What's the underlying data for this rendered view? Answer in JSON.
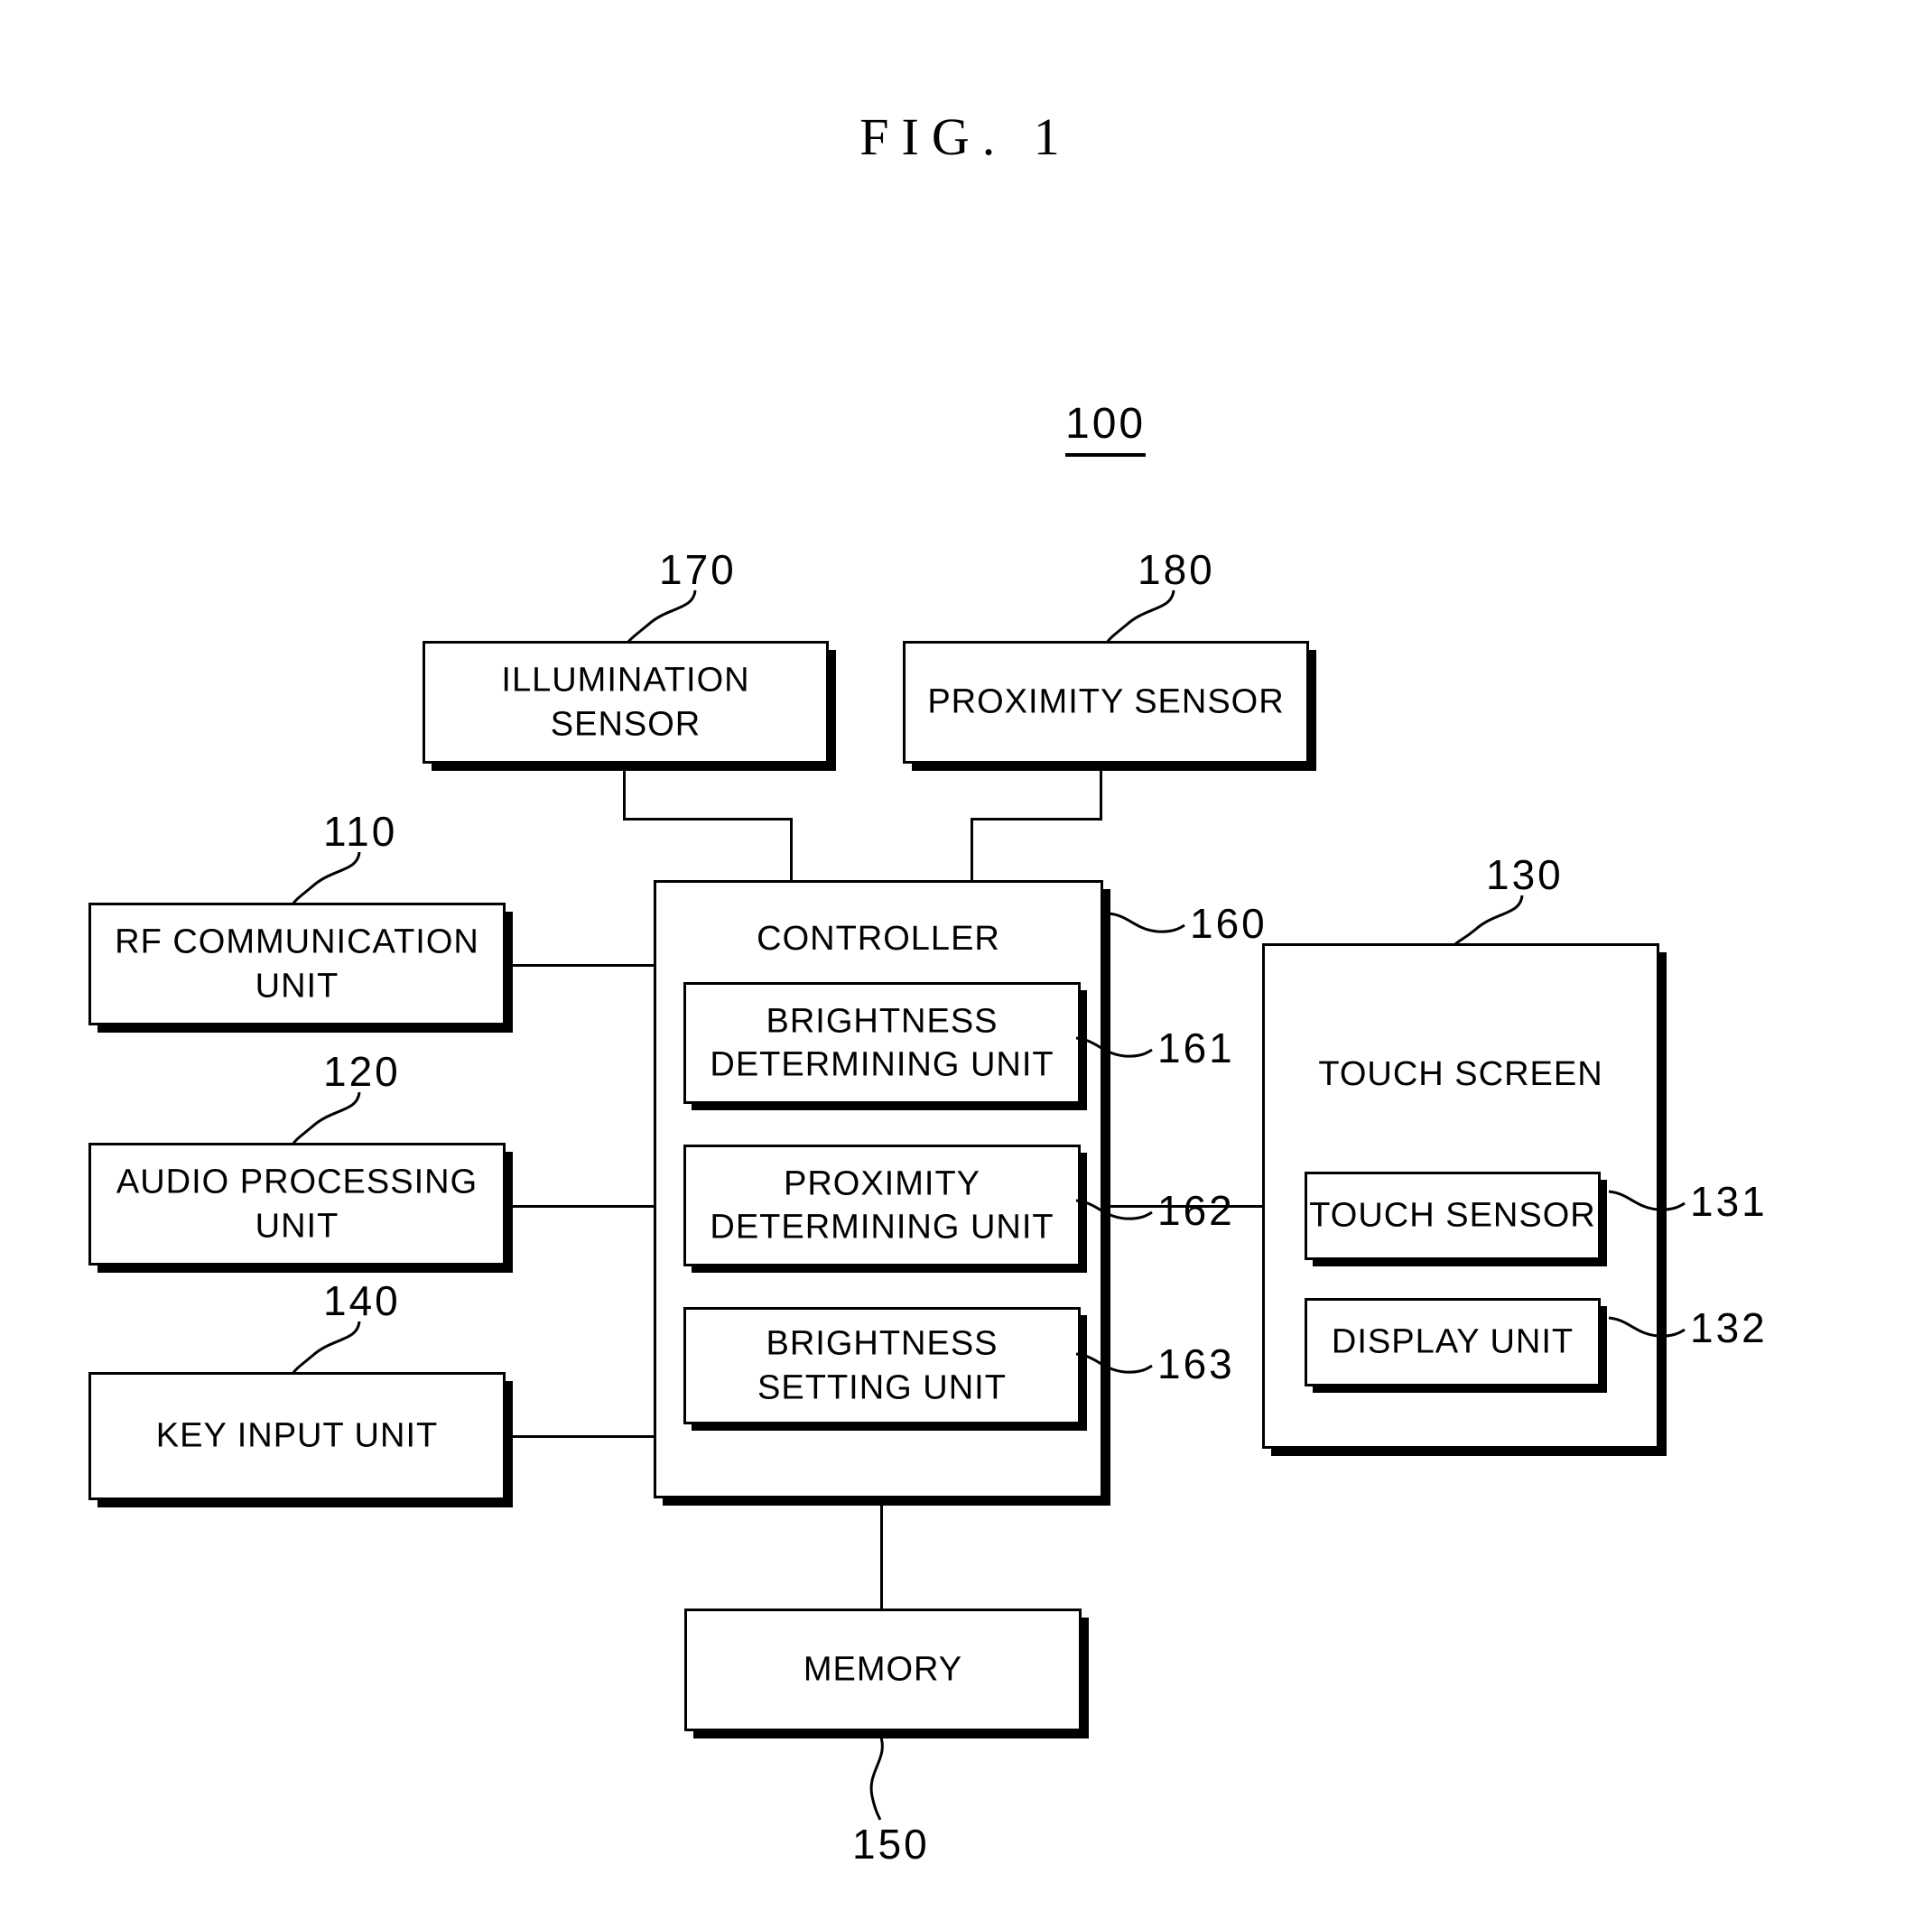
{
  "figure": {
    "title": "FIG. 1",
    "system_ref": "100"
  },
  "blocks": {
    "illumination_sensor": {
      "label": "ILLUMINATION SENSOR",
      "ref": "170"
    },
    "proximity_sensor": {
      "label": "PROXIMITY SENSOR",
      "ref": "180"
    },
    "rf_communication": {
      "label": "RF COMMUNICATION UNIT",
      "ref": "110"
    },
    "audio_processing": {
      "label": "AUDIO PROCESSING UNIT",
      "ref": "120"
    },
    "key_input": {
      "label": "KEY INPUT UNIT",
      "ref": "140"
    },
    "controller": {
      "label": "CONTROLLER",
      "ref": "160"
    },
    "brightness_determining": {
      "label": "BRIGHTNESS\nDETERMINING UNIT",
      "ref": "161"
    },
    "proximity_determining": {
      "label": "PROXIMITY\nDETERMINING UNIT",
      "ref": "162"
    },
    "brightness_setting": {
      "label": "BRIGHTNESS SETTING UNIT",
      "ref": "163"
    },
    "touch_screen": {
      "label": "TOUCH SCREEN",
      "ref": "130"
    },
    "touch_sensor": {
      "label": "TOUCH SENSOR",
      "ref": "131"
    },
    "display_unit": {
      "label": "DISPLAY UNIT",
      "ref": "132"
    },
    "memory": {
      "label": "MEMORY",
      "ref": "150"
    }
  },
  "colors": {
    "line": "#000000",
    "background": "#ffffff"
  }
}
